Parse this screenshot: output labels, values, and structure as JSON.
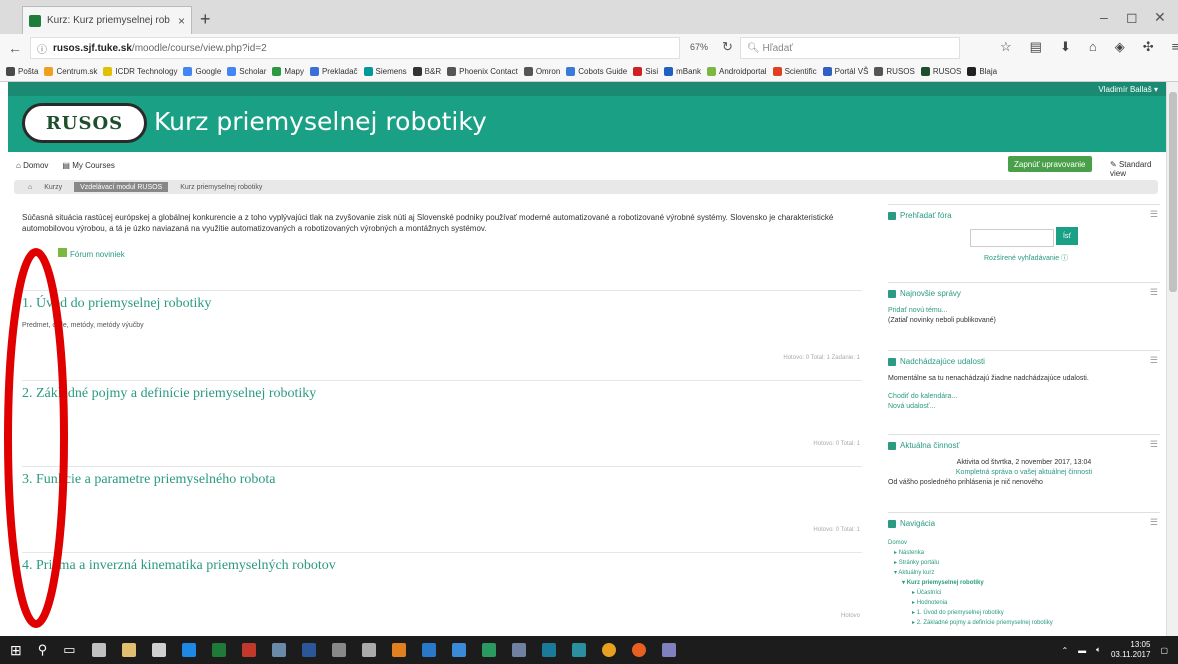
{
  "browser": {
    "tab_title": "Kurz: Kurz priemyselnej rob",
    "url_host": "rusos.sjf.tuke.sk",
    "url_path": "/moodle/course/view.php?id=2",
    "zoom": "67%",
    "search_placeholder": "Hľadať",
    "new_tab": "+",
    "tab_close": "×"
  },
  "bookmarks": [
    {
      "label": "Pošta",
      "color": "#4a4a4a"
    },
    {
      "label": "Centrum.sk",
      "color": "#f0a020"
    },
    {
      "label": "ICDR Technology",
      "color": "#e0c000"
    },
    {
      "label": "Google",
      "color": "#4285f4"
    },
    {
      "label": "Scholar",
      "color": "#4285f4"
    },
    {
      "label": "Mapy",
      "color": "#2a9a40"
    },
    {
      "label": "Prekladač",
      "color": "#3a6fd8"
    },
    {
      "label": "Siemens",
      "color": "#009999"
    },
    {
      "label": "B&R",
      "color": "#333333"
    },
    {
      "label": "Phoenix Contact",
      "color": "#555555"
    },
    {
      "label": "Omron",
      "color": "#555555"
    },
    {
      "label": "Cobots Guide",
      "color": "#3a7ad8"
    },
    {
      "label": "Sisi",
      "color": "#d02020"
    },
    {
      "label": "mBank",
      "color": "#2060c0"
    },
    {
      "label": "Androidportal",
      "color": "#7ab840"
    },
    {
      "label": "Scientific",
      "color": "#e04020"
    },
    {
      "label": "Portál VŠ",
      "color": "#3060c0"
    },
    {
      "label": "RUSOS",
      "color": "#555555"
    },
    {
      "label": "RUSOS",
      "color": "#1e4f2d"
    },
    {
      "label": "Blaja",
      "color": "#222222"
    }
  ],
  "site": {
    "logo_text": "RUSOS",
    "title": "Kurz priemyselnej robotiky",
    "user_menu": "Vladimír Ballaš"
  },
  "coursenav": {
    "home": "Domov",
    "my_courses": "My Courses",
    "edit_button": "Zapnúť upravovanie",
    "view_link": "Standard view"
  },
  "breadcrumb": {
    "items": [
      "Kurzy",
      "Vzdelávací modul RUSOS",
      "Kurz priemyselnej robotiky"
    ]
  },
  "main": {
    "intro": "Súčasná situácia rastúcej európskej a globálnej konkurencie a z toho vyplývajúci tlak na zvyšovanie zisk núti aj Slovenské podniky používať moderné automatizované a robotizované výrobné systémy. Slovensko je charakteristické automobilovou výrobou, a tá je úzko naviazaná na využitie automatizovaných a robotizovaných výrobných a montážnych systémov.",
    "forum_link": "Fórum noviniek",
    "sections": [
      {
        "title": "1. Úvod do priemyselnej robotiky",
        "summary": "Predmet, ciele, metódy, metódy výučby",
        "meta": "Hotovo: 0  Total: 1  Zadanie: 1"
      },
      {
        "title": "2. Základné pojmy a definície priemyselnej robotiky",
        "summary": "",
        "meta": "Hotovo: 0  Total: 1"
      },
      {
        "title": "3. Funkcie a parametre priemyselného robota",
        "summary": "",
        "meta": "Hotovo: 0  Total: 1"
      },
      {
        "title": "4. Priama a inverzná kinematika priemyselných robotov",
        "summary": "",
        "meta": "Hotovo"
      }
    ]
  },
  "blocks": {
    "search": {
      "title": "Prehľadať fóra",
      "button": "Ísť",
      "advanced": "Rozšírené vyhľadávanie"
    },
    "news": {
      "title": "Najnovšie správy",
      "link": "Pridať novú tému...",
      "text": "(Zatiaľ novinky neboli publikované)"
    },
    "events": {
      "title": "Nadchádzajúce udalosti",
      "text": "Momentálne sa tu nenachádzajú žiadne nadchádzajúce udalosti.",
      "link1": "Chodiť do kalendára...",
      "link2": "Nová udalosť..."
    },
    "activity": {
      "title": "Aktuálna činnosť",
      "line1": "Aktivita od štvrtka, 2 november 2017, 13:04",
      "line2": "Kompletná správa o vašej aktuálnej činnosti",
      "line3": "Od vášho posledného prihlásenia je nič nenového"
    },
    "navigation": {
      "title": "Navigácia",
      "items": [
        "Domov",
        "Nástenka",
        "Stránky portálu",
        "Aktuálny kurz",
        "Kurz priemyselnej robotiky",
        "Účastníci",
        "Hodnotenia",
        "1. Úvod do priemyselnej robotiky",
        "2. Základné pojmy a definície priemyselnej robotiky"
      ]
    }
  },
  "taskbar": {
    "clock_time": "13:05",
    "clock_date": "03.11.2017"
  }
}
